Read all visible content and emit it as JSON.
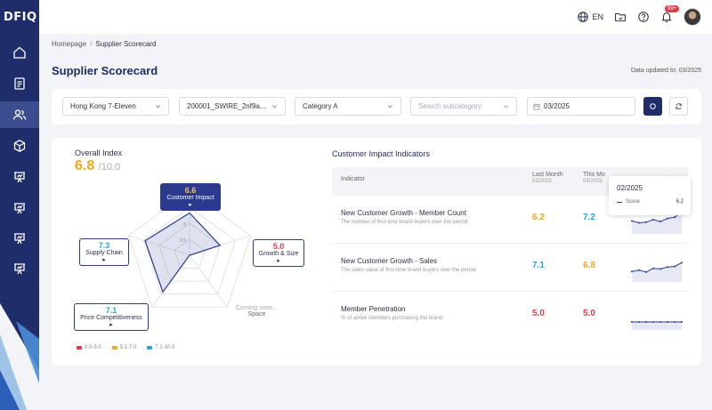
{
  "brand": {
    "logo_text": "DFIQ"
  },
  "sidebar": {
    "items": [
      {
        "icon": "home-icon"
      },
      {
        "icon": "document-icon"
      },
      {
        "icon": "users-icon",
        "active": true
      },
      {
        "icon": "box-icon"
      },
      {
        "icon": "presentation-icon"
      },
      {
        "icon": "presentation-icon"
      },
      {
        "icon": "presentation-icon"
      },
      {
        "icon": "presentation-icon"
      }
    ]
  },
  "topbar": {
    "language": "EN",
    "notifications_badge": "99+"
  },
  "breadcrumb": {
    "home": "Homepage",
    "separator": "/",
    "current": "Supplier Scorecard"
  },
  "page": {
    "title": "Supplier Scorecard",
    "updated": "Data updated to: 03/2025"
  },
  "filters": {
    "store": "Hong Kong 7-Eleven",
    "supplier": "200001_SWIRE_2nf9a...",
    "category": "Category A",
    "subcategory_placeholder": "Search subcategory",
    "date": "03/2025"
  },
  "overall": {
    "title": "Overall Index",
    "score": "6.8",
    "max": "/10.0"
  },
  "radar": {
    "axes": [
      {
        "label": "Customer Impact",
        "value": "6.6",
        "score": 6.6
      },
      {
        "label": "Growth & Size",
        "value": "5.0",
        "score": 5.0
      },
      {
        "label": "Space",
        "value": "",
        "score": 0
      },
      {
        "label": "Price Competitiveness",
        "value": "7.1",
        "score": 7.1
      },
      {
        "label": "Supply Chain",
        "value": "7.3",
        "score": 7.3
      }
    ],
    "coming_soon": "Coming soon...",
    "space_label": "Space",
    "ticks": [
      "10",
      "7.5",
      "5",
      "2.5"
    ],
    "legend": [
      {
        "label": "0.0-5.0",
        "color": "#e5394a"
      },
      {
        "label": "5.1-7.0",
        "color": "#f0a81c"
      },
      {
        "label": "7.1-10.0",
        "color": "#2aa3e0"
      }
    ]
  },
  "indicators": {
    "title": "Customer Impact Indicators",
    "headers": {
      "indicator": "Indicator",
      "last_month": "Last Month",
      "last_month_sub": "02/2025",
      "this_month": "This Mo",
      "this_month_sub": "03/2025",
      "trend": "nths"
    },
    "rows": [
      {
        "name": "New Customer Growth - Member Count",
        "desc": "The number of first-time brand buyers over the period",
        "last": "6.2",
        "last_color": "#f0a81c",
        "this": "7.2",
        "this_color": "#2aa3e0",
        "trend": [
          5.8,
          5.5,
          5.6,
          6.0,
          5.7,
          6.2,
          6.4,
          7.2
        ]
      },
      {
        "name": "New Customer Growth - Sales",
        "desc": "The sales value of first-time brand buyers over the period",
        "last": "7.1",
        "last_color": "#2aa3e0",
        "this": "6.8",
        "this_color": "#f0a81c",
        "trend": [
          5.4,
          5.6,
          5.3,
          5.9,
          5.8,
          6.1,
          6.2,
          6.8
        ]
      },
      {
        "name": "Member Penetration",
        "desc": "% of active members purchasing the brand",
        "last": "5.0",
        "last_color": "#e5394a",
        "this": "5.0",
        "this_color": "#e5394a",
        "trend": [
          5.0,
          5.0,
          5.0,
          5.0,
          5.0,
          5.0,
          5.0,
          5.0
        ]
      }
    ]
  },
  "tooltip": {
    "date": "02/2025",
    "series": "Score",
    "value": "6.2"
  }
}
